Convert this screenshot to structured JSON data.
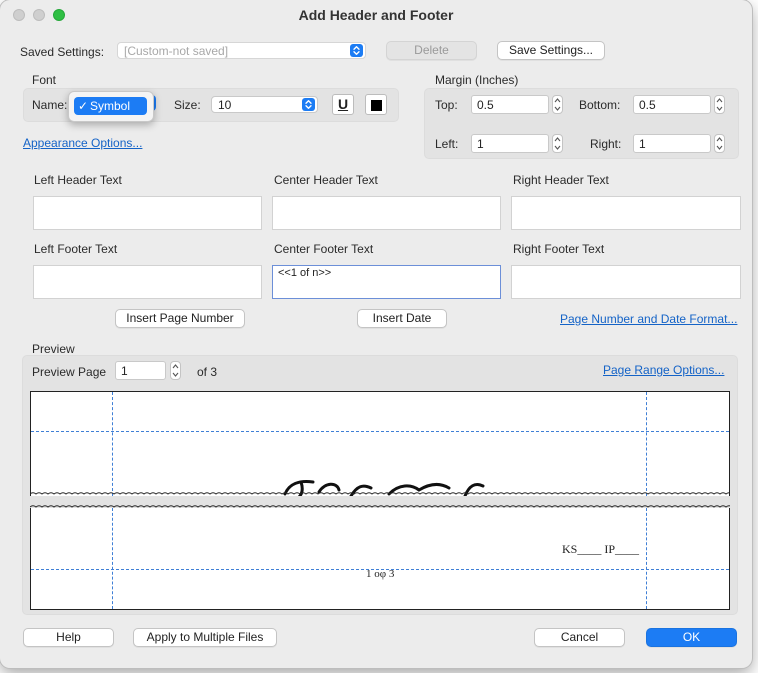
{
  "dialog": {
    "title": "Add Header and Footer"
  },
  "saved_settings": {
    "label": "Saved Settings:",
    "value": "[Custom-not saved]",
    "delete_label": "Delete",
    "save_label": "Save Settings..."
  },
  "font": {
    "group_label": "Font",
    "name_label": "Name:",
    "name_value": "Symbol",
    "size_label": "Size:",
    "size_value": "10",
    "underline_label": "U"
  },
  "margin": {
    "group_label": "Margin (Inches)",
    "top_label": "Top:",
    "top_value": "0.5",
    "bottom_label": "Bottom:",
    "bottom_value": "0.5",
    "left_label": "Left:",
    "left_value": "1",
    "right_label": "Right:",
    "right_value": "1"
  },
  "appearance_link": "Appearance Options...",
  "header_footer": {
    "left_header_label": "Left Header Text",
    "center_header_label": "Center Header Text",
    "right_header_label": "Right Header Text",
    "left_footer_label": "Left Footer Text",
    "center_footer_label": "Center Footer Text",
    "right_footer_label": "Right Footer Text",
    "center_footer_value": "<<1 of n>>"
  },
  "actions": {
    "insert_page_number": "Insert Page Number",
    "insert_date": "Insert Date",
    "page_format_link": "Page Number and Date Format..."
  },
  "preview": {
    "group_label": "Preview",
    "page_label": "Preview Page",
    "page_value": "1",
    "of_label": "of 3",
    "range_link": "Page Range Options...",
    "signature_fields": "KS____ IP____",
    "footer_sample": "1 oφ 3"
  },
  "footer_buttons": {
    "help": "Help",
    "apply_multiple": "Apply to Multiple Files",
    "cancel": "Cancel",
    "ok": "OK"
  },
  "colors": {
    "accent": "#1c7cf4",
    "link": "#1463c7",
    "guide": "#3f7fd6"
  },
  "icons": [
    "close-icon",
    "minimize-icon",
    "zoom-icon",
    "chevron-updown-icon",
    "checkmark-icon",
    "stepper-icon"
  ]
}
